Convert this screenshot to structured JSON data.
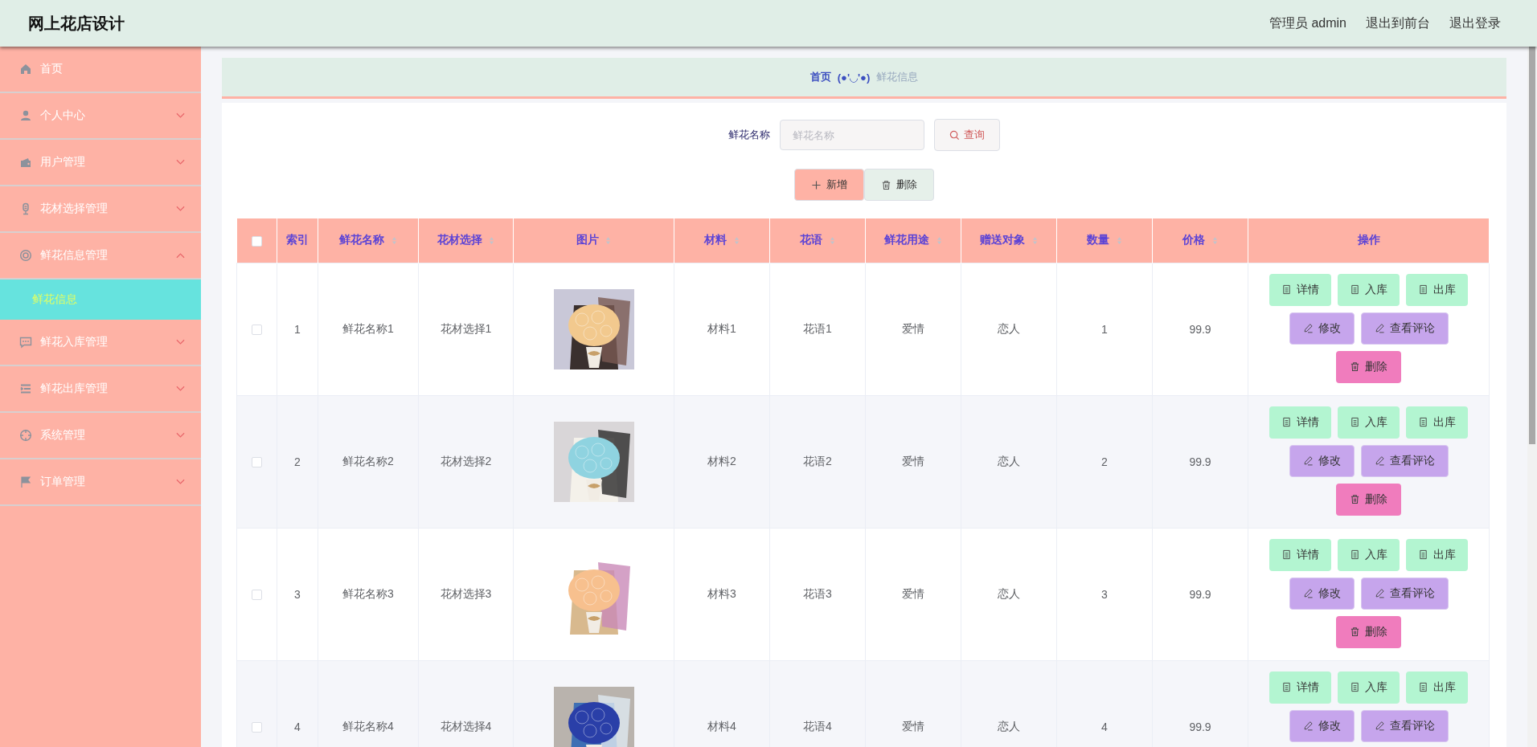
{
  "header": {
    "title": "网上花店设计",
    "links": [
      "管理员 admin",
      "退出到前台",
      "退出登录"
    ]
  },
  "sidebar": {
    "items": [
      {
        "label": "首页",
        "kind": "link"
      },
      {
        "label": "个人中心",
        "kind": "menu",
        "expanded": false
      },
      {
        "label": "用户管理",
        "kind": "menu",
        "expanded": false
      },
      {
        "label": "花材选择管理",
        "kind": "menu",
        "expanded": false
      },
      {
        "label": "鲜花信息管理",
        "kind": "menu",
        "expanded": true,
        "children": [
          {
            "label": "鲜花信息",
            "selected": true
          }
        ]
      },
      {
        "label": "鲜花入库管理",
        "kind": "menu",
        "expanded": false
      },
      {
        "label": "鲜花出库管理",
        "kind": "menu",
        "expanded": false
      },
      {
        "label": "系统管理",
        "kind": "menu",
        "expanded": false
      },
      {
        "label": "订单管理",
        "kind": "menu",
        "expanded": false
      }
    ]
  },
  "breadcrumb": {
    "home": "首页",
    "separator": "(●'◡'●)",
    "current": "鲜花信息"
  },
  "search": {
    "label": "鲜花名称",
    "placeholder": "鲜花名称",
    "button": "查询"
  },
  "toolbar": [
    {
      "label": "新增",
      "kind": "add"
    },
    {
      "label": "删除",
      "kind": "delete"
    }
  ],
  "table": {
    "select_all": {
      "checked": false
    },
    "columns": [
      {
        "label": "索引",
        "sortable": false
      },
      {
        "label": "鲜花名称",
        "sortable": true
      },
      {
        "label": "花材选择",
        "sortable": true
      },
      {
        "label": "图片",
        "sortable": true
      },
      {
        "label": "材料",
        "sortable": true
      },
      {
        "label": "花语",
        "sortable": true
      },
      {
        "label": "鲜花用途",
        "sortable": true
      },
      {
        "label": "赠送对象",
        "sortable": true
      },
      {
        "label": "数量",
        "sortable": true
      },
      {
        "label": "价格",
        "sortable": true
      },
      {
        "label": "操作",
        "sortable": false
      }
    ],
    "rows": [
      {
        "checked": false,
        "cells": [
          "1",
          "鲜花名称1",
          "花材选择1",
          null,
          "材料1",
          "花语1",
          "爱情",
          "恋人",
          "1",
          "99.9"
        ],
        "image": {
          "kind": "picture"
        },
        "actions": [
          {
            "label": "详情",
            "kind": "view"
          },
          {
            "label": "入库",
            "kind": "view"
          },
          {
            "label": "出库",
            "kind": "view"
          },
          {
            "label": "修改",
            "kind": "edit"
          },
          {
            "label": "查看评论",
            "kind": "edit"
          },
          {
            "label": "删除",
            "kind": "delete"
          }
        ]
      },
      {
        "checked": false,
        "cells": [
          "2",
          "鲜花名称2",
          "花材选择2",
          null,
          "材料2",
          "花语2",
          "爱情",
          "恋人",
          "2",
          "99.9"
        ],
        "image": {
          "kind": "picture"
        },
        "actions": [
          {
            "label": "详情",
            "kind": "view"
          },
          {
            "label": "入库",
            "kind": "view"
          },
          {
            "label": "出库",
            "kind": "view"
          },
          {
            "label": "修改",
            "kind": "edit"
          },
          {
            "label": "查看评论",
            "kind": "edit"
          },
          {
            "label": "删除",
            "kind": "delete"
          }
        ]
      },
      {
        "checked": false,
        "cells": [
          "3",
          "鲜花名称3",
          "花材选择3",
          null,
          "材料3",
          "花语3",
          "爱情",
          "恋人",
          "3",
          "99.9"
        ],
        "image": {
          "kind": "picture"
        },
        "actions": [
          {
            "label": "详情",
            "kind": "view"
          },
          {
            "label": "入库",
            "kind": "view"
          },
          {
            "label": "出库",
            "kind": "view"
          },
          {
            "label": "修改",
            "kind": "edit"
          },
          {
            "label": "查看评论",
            "kind": "edit"
          },
          {
            "label": "删除",
            "kind": "delete"
          }
        ]
      },
      {
        "checked": false,
        "cells": [
          "4",
          "鲜花名称4",
          "花材选择4",
          null,
          "材料4",
          "花语4",
          "爱情",
          "恋人",
          "4",
          "99.9"
        ],
        "image": {
          "kind": "picture"
        },
        "actions": [
          {
            "label": "详情",
            "kind": "view"
          },
          {
            "label": "入库",
            "kind": "view"
          },
          {
            "label": "出库",
            "kind": "view"
          },
          {
            "label": "修改",
            "kind": "edit"
          },
          {
            "label": "查看评论",
            "kind": "edit"
          }
        ]
      }
    ]
  }
}
